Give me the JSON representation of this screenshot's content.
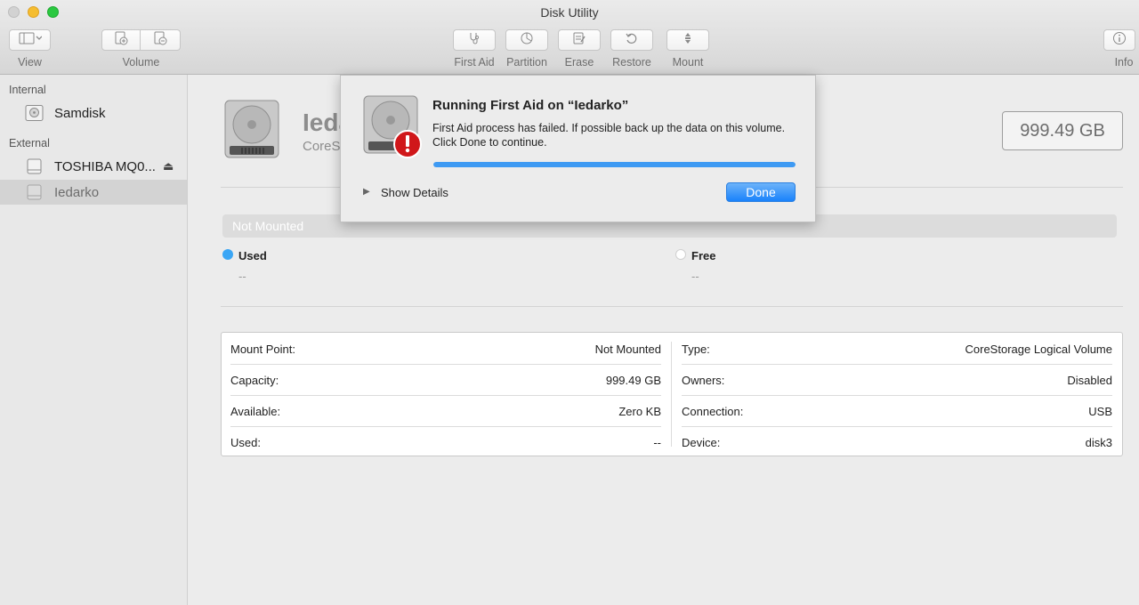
{
  "window": {
    "title": "Disk Utility"
  },
  "toolbar": {
    "view_label": "View",
    "volume_label": "Volume",
    "first_aid_label": "First Aid",
    "partition_label": "Partition",
    "erase_label": "Erase",
    "restore_label": "Restore",
    "mount_label": "Mount",
    "info_label": "Info"
  },
  "sidebar": {
    "internal_header": "Internal",
    "external_header": "External",
    "items": [
      {
        "label": "Samdisk",
        "icon": "internal-disk-icon"
      },
      {
        "label": "TOSHIBA MQ0...",
        "icon": "external-disk-icon"
      },
      {
        "label": "Iedarko",
        "icon": "volume-icon"
      }
    ]
  },
  "main": {
    "volume_name": "Ieda",
    "volume_subtitle": "CoreS",
    "capacity": "999.49 GB",
    "usage_bar_label": "Not Mounted",
    "used_label": "Used",
    "used_value": "--",
    "free_label": "Free",
    "free_value": "--",
    "colors": {
      "used": "#3aa6f5",
      "free": "#ffffff"
    },
    "info_left": [
      {
        "key": "Mount Point:",
        "value": "Not Mounted"
      },
      {
        "key": "Capacity:",
        "value": "999.49 GB"
      },
      {
        "key": "Available:",
        "value": "Zero KB"
      },
      {
        "key": "Used:",
        "value": "--"
      }
    ],
    "info_right": [
      {
        "key": "Type:",
        "value": "CoreStorage Logical Volume"
      },
      {
        "key": "Owners:",
        "value": "Disabled"
      },
      {
        "key": "Connection:",
        "value": "USB"
      },
      {
        "key": "Device:",
        "value": "disk3"
      }
    ]
  },
  "sheet": {
    "title": "Running First Aid on “Iedarko”",
    "message": "First Aid process has failed. If possible back up the data on this volume. Click Done to continue.",
    "progress": 1.0,
    "show_details_label": "Show Details",
    "done_label": "Done",
    "icon": "disk-error-icon"
  }
}
